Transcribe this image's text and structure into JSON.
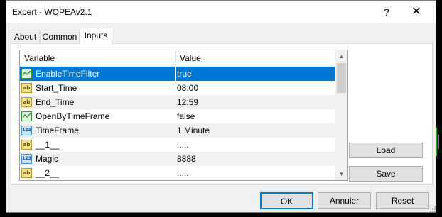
{
  "window": {
    "title": "Expert - WOPEAv2.1",
    "help_glyph": "?",
    "close_glyph": "✕"
  },
  "tabs": [
    {
      "label": "About",
      "active": false
    },
    {
      "label": "Common",
      "active": false
    },
    {
      "label": "Inputs",
      "active": true
    }
  ],
  "grid": {
    "columns": {
      "variable": "Variable",
      "value": "Value"
    },
    "rows": [
      {
        "icon": "bool-icon",
        "variable": "EnableTimeFilter",
        "value": "true",
        "selected": true
      },
      {
        "icon": "string-icon",
        "variable": "Start_Time",
        "value": "08:00"
      },
      {
        "icon": "string-icon",
        "variable": "End_Time",
        "value": "12:59"
      },
      {
        "icon": "bool-icon",
        "variable": "OpenByTimeFrame",
        "value": "false"
      },
      {
        "icon": "number-icon",
        "variable": "TimeFrame",
        "value": "1 Minute"
      },
      {
        "icon": "string-icon",
        "variable": "__1__",
        "value": "....."
      },
      {
        "icon": "number-icon",
        "variable": "Magic",
        "value": "8888"
      },
      {
        "icon": "string-icon",
        "variable": "__2__",
        "value": "....."
      }
    ],
    "scroll_up_glyph": "▲",
    "scroll_down_glyph": "▼",
    "string_icon_text": "ab",
    "number_icon_text": "123"
  },
  "buttons": {
    "load": "Load",
    "save": "Save",
    "ok": "OK",
    "cancel": "Annuler",
    "reset": "Reset"
  },
  "colors": {
    "selection": "#0078d7",
    "default_button_border": "#0078d7",
    "bool_icon": "#3a9a3a"
  }
}
